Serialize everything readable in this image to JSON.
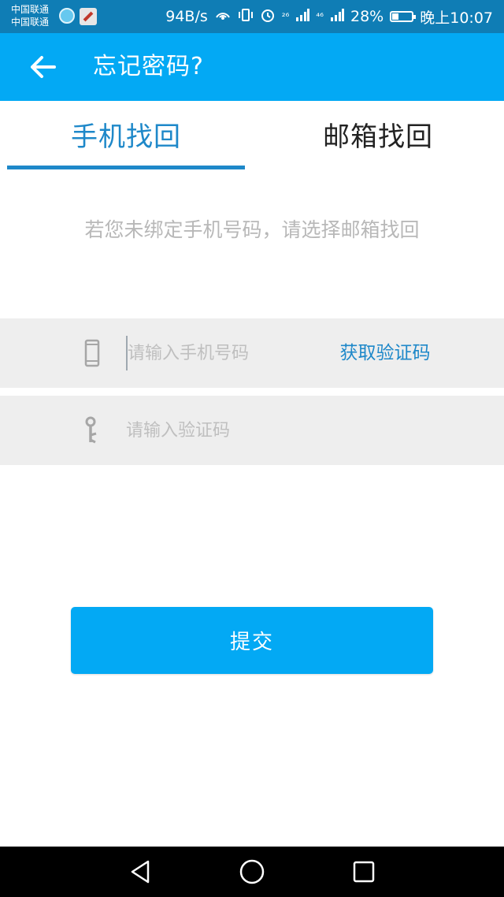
{
  "status_bar": {
    "carrier_1": "中国联通",
    "carrier_2": "中国联通",
    "net_speed": "94B/s",
    "signal_2g": "²⁶",
    "signal_4g": "⁴⁶",
    "battery": "28%",
    "time": "晚上10:07",
    "icons": [
      "app-notification-icon",
      "edit-icon",
      "hotspot-icon",
      "vibrate-icon",
      "alarm-icon",
      "signal-icon",
      "signal-icon",
      "battery-icon"
    ]
  },
  "app_bar": {
    "back_icon": "arrow-left-icon",
    "title": "忘记密码?"
  },
  "tabs": [
    {
      "label": "手机找回",
      "selected": true
    },
    {
      "label": "邮箱找回",
      "selected": false
    }
  ],
  "hint": "若您未绑定手机号码，请选择邮箱找回",
  "phone_row": {
    "icon": "phone-icon",
    "placeholder": "请输入手机号码",
    "value": "",
    "get_code_label": "获取验证码"
  },
  "code_row": {
    "icon": "key-icon",
    "placeholder": "请输入验证码",
    "value": ""
  },
  "submit_label": "提交",
  "nav_bar": {
    "icons": [
      "back-triangle-icon",
      "home-circle-icon",
      "recents-square-icon"
    ]
  },
  "colors": {
    "status_bar": "#0f7db5",
    "app_bar": "#03a9f4",
    "accent": "#1e88c9",
    "input_bg": "#eeeeee",
    "hint_text": "#b8b8b8"
  }
}
